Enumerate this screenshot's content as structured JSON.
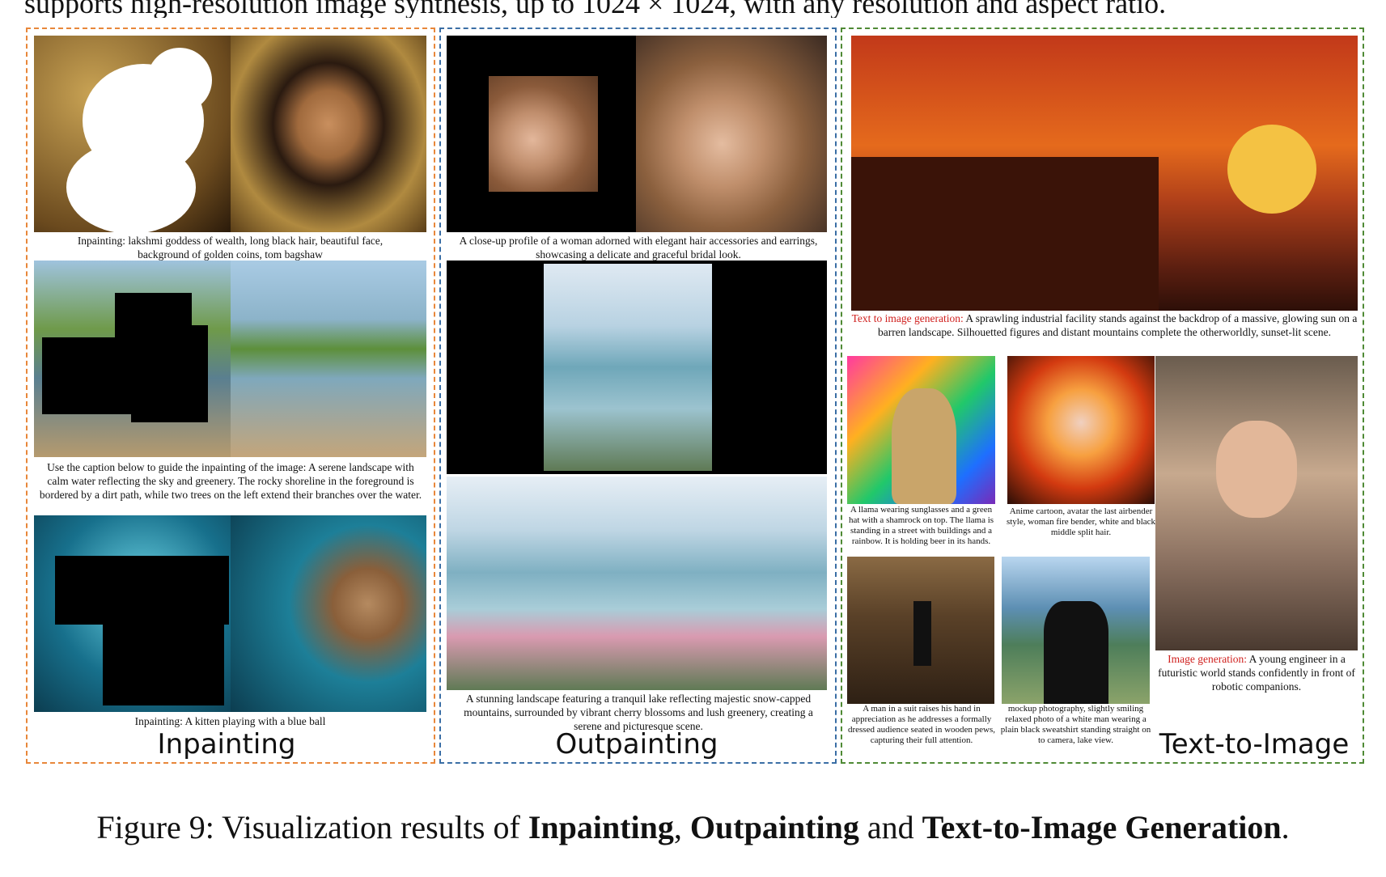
{
  "top_text": "supports high-resolution image synthesis, up to 1024 × 1024, with any resolution and aspect ratio.",
  "sections": {
    "inpainting": {
      "title": "Inpainting",
      "captions": [
        "Inpainting: lakshmi goddess of wealth, long black hair, beautiful face, background of golden coins, tom bagshaw",
        "Use the caption below to guide the inpainting of the image: A serene landscape with calm water reflecting the sky and greenery. The rocky shoreline in the foreground is bordered by a dirt path, while two trees on the left extend their branches over the water.",
        "Inpainting: A kitten playing with a blue ball"
      ]
    },
    "outpainting": {
      "title": "Outpainting",
      "captions": [
        "A close-up profile of a woman adorned with elegant hair accessories and earrings, showcasing a delicate and graceful bridal look.",
        "A stunning landscape featuring a tranquil lake reflecting majestic snow-capped mountains, surrounded by vibrant cherry blossoms and lush greenery, creating a serene and picturesque scene."
      ]
    },
    "text_to_image": {
      "title": "Text-to-Image",
      "main_caption_label": "Text to image generation:",
      "main_caption_text": " A sprawling industrial facility stands against the backdrop of a massive, glowing sun on a barren landscape. Silhouetted figures and distant mountains complete the otherworldly, sunset-lit scene.",
      "llama_caption": "A llama wearing sunglasses and a green hat with a shamrock on top. The llama is standing in a street with buildings and a rainbow. It is holding beer in its hands.",
      "anime_caption": "Anime cartoon, avatar the last airbender style, woman fire bender, white and black middle split hair.",
      "conductor_caption": "A man in a suit raises his hand in appreciation as he addresses a formally dressed audience seated in wooden pews, capturing their full attention.",
      "man_caption": "mockup photography, slightly smiling relaxed photo of a white man wearing a plain black sweatshirt standing straight on to camera, lake view.",
      "engineer_caption_label": "Image generation:",
      "engineer_caption_text": " A young engineer in a futuristic world stands confidently in front of robotic companions."
    }
  },
  "figure_caption": {
    "prefix": "Figure 9: Visualization results of ",
    "term1": "Inpainting",
    "sep1": ", ",
    "term2": "Outpainting",
    "sep2": " and ",
    "term3": "Text-to-Image Generation",
    "suffix": "."
  }
}
